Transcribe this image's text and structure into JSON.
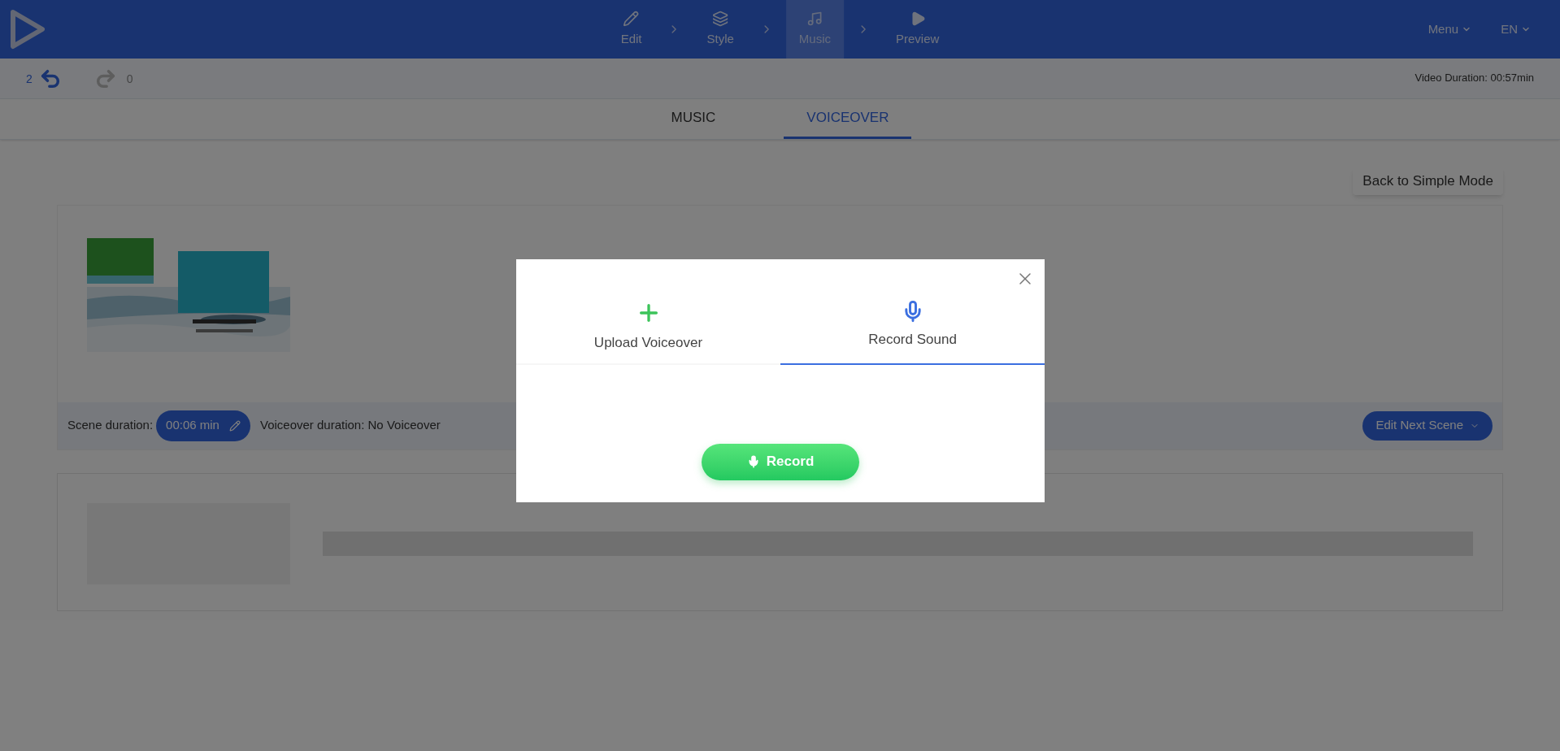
{
  "header": {
    "steps": [
      {
        "label": "Edit",
        "kind": "edit",
        "selected": false
      },
      {
        "label": "Style",
        "kind": "style",
        "selected": false
      },
      {
        "label": "Music",
        "kind": "music",
        "selected": true
      },
      {
        "label": "Preview",
        "kind": "preview",
        "selected": false
      }
    ],
    "menu": "Menu",
    "language": "EN"
  },
  "history": {
    "undo_count": "2",
    "redo_count": "0",
    "video_duration": "Video Duration: 00:57min"
  },
  "tabs": [
    {
      "label": "MUSIC",
      "selected": false
    },
    {
      "label": "VOICEOVER",
      "selected": true
    }
  ],
  "back_button": "Back to Simple Mode",
  "scene": {
    "duration_label": "Scene duration:",
    "duration": "00:06 min",
    "voiceover": "Voiceover duration: No Voiceover",
    "next_button": "Edit Next Scene"
  },
  "modal": {
    "tabs": [
      {
        "label": "Upload Voiceover",
        "kind": "upload",
        "selected": false
      },
      {
        "label": "Record Sound",
        "kind": "record",
        "selected": true
      }
    ],
    "record_button": "Record"
  }
}
